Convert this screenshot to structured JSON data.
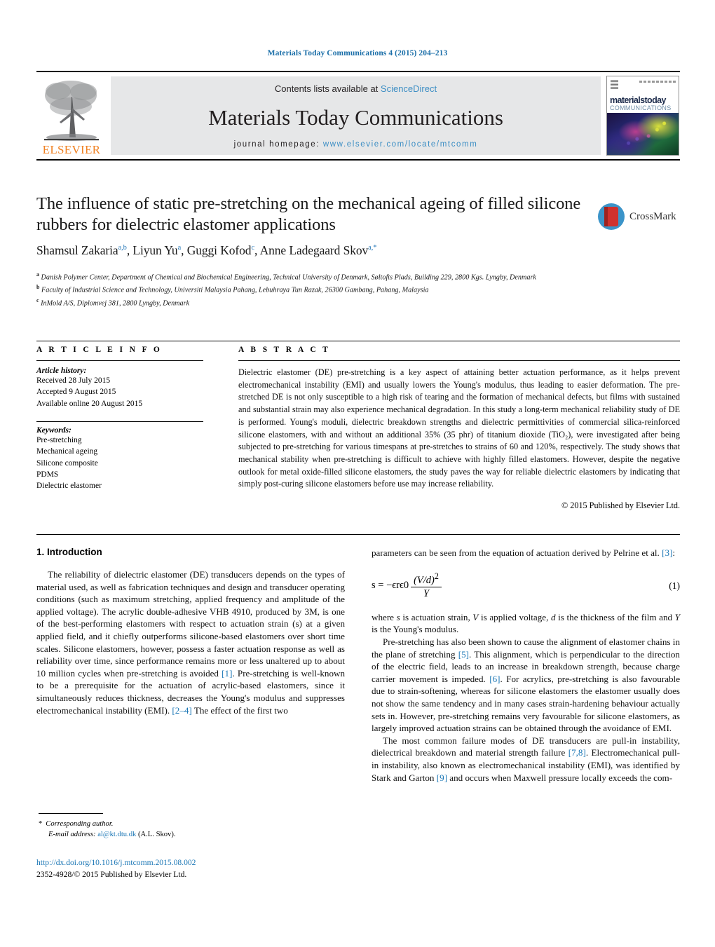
{
  "running_head": "Materials Today Communications 4 (2015) 204–213",
  "masthead": {
    "publisher_word": "ELSEVIER",
    "contents_prefix": "Contents lists available at ",
    "contents_link": "ScienceDirect",
    "journal_name": "Materials Today Communications",
    "homepage_prefix": "journal homepage: ",
    "homepage_url": "www.elsevier.com/locate/mtcomm",
    "cover": {
      "title": "materialstoday",
      "subtitle": "COMMUNICATIONS"
    }
  },
  "article": {
    "title": "The influence of static pre-stretching on the mechanical ageing of filled silicone rubbers for dielectric elastomer applications",
    "crossmark_label": "CrossMark",
    "authors_html": "Shamsul Zakaria<sup>a,b</sup>, Liyun Yu<sup>a</sup>, Guggi Kofod<sup>c</sup>, Anne Ladegaard Skov<sup>a,*</sup>",
    "affiliations": [
      {
        "marker": "a",
        "text": "Danish Polymer Center, Department of Chemical and Biochemical Engineering, Technical University of Denmark, Søltofts Plads, Building 229, 2800 Kgs. Lyngby, Denmark"
      },
      {
        "marker": "b",
        "text": "Faculty of Industrial Science and Technology, Universiti Malaysia Pahang, Lebuhraya Tun Razak, 26300 Gambang, Pahang, Malaysia"
      },
      {
        "marker": "c",
        "text": "InMold A/S, Diplomvej 381, 2800 Lyngby, Denmark"
      }
    ]
  },
  "article_info": {
    "heading": "A R T I C L E    I N F O",
    "history_label": "Article history:",
    "history": [
      "Received 28 July 2015",
      "Accepted 9 August 2015",
      "Available online 20 August 2015"
    ],
    "keywords_label": "Keywords:",
    "keywords": [
      "Pre-stretching",
      "Mechanical ageing",
      "Silicone composite",
      "PDMS",
      "Dielectric elastomer"
    ]
  },
  "abstract": {
    "heading": "A B S T R A C T",
    "text": "Dielectric elastomer (DE) pre-stretching is a key aspect of attaining better actuation performance, as it helps prevent electromechanical instability (EMI) and usually lowers the Young's modulus, thus leading to easier deformation. The pre-stretched DE is not only susceptible to a high risk of tearing and the formation of mechanical defects, but films with sustained and substantial strain may also experience mechanical degradation. In this study a long-term mechanical reliability study of DE is performed. Young's moduli, dielectric breakdown strengths and dielectric permittivities of commercial silica-reinforced silicone elastomers, with and without an additional 35% (35 phr) of titanium dioxide (TiO₂), were investigated after being subjected to pre-stretching for various timespans at pre-stretches to strains of 60 and 120%, respectively. The study shows that mechanical stability when pre-stretching is difficult to achieve with highly filled elastomers. However, despite the negative outlook for metal oxide-filled silicone elastomers, the study paves the way for reliable dielectric elastomers by indicating that simply post-curing silicone elastomers before use may increase reliability.",
    "copyright": "© 2015 Published by Elsevier Ltd."
  },
  "body": {
    "section_heading": "1.  Introduction",
    "left_p1_html": "The reliability of dielectric elastomer (DE) transducers depends on the types of material used, as well as fabrication techniques and design and transducer operating conditions (such as maximum stretching, applied frequency and amplitude of the applied voltage). The acrylic double-adhesive VHB 4910, produced by 3M, is one of the best-performing elastomers with respect to actuation strain (s) at a given applied field, and it chiefly outperforms silicone-based elastomers over short time scales. Silicone elastomers, however, possess a faster actuation response as well as reliability over time, since performance remains more or less unaltered up to about 10 million cycles when pre-stretching is avoided <span class=\"ref\">[1]</span>. Pre-stretching is well-known to be a prerequisite for the actuation of acrylic-based elastomers, since it simultaneously reduces thickness, decreases the Young's modulus and suppresses electromechanical instability (EMI). <span class=\"ref\">[2–4]</span> The effect of the first two",
    "right_p1_html": "parameters can be seen from the equation of actuation derived by Pelrine et al. <span class=\"ref\">[3]</span>:",
    "equation": {
      "lhs": "s = −",
      "eps_r": "ϵr",
      "eps_0": "ϵ0",
      "numerator": "(V/d)",
      "exponent": "2",
      "denominator": "Y",
      "number": "(1)"
    },
    "right_p2_html": "where <i>s</i> is actuation strain, <i>V</i> is applied voltage, <i>d</i> is the thickness of the film and <i>Y</i> is the Young's modulus.",
    "right_p3_html": "Pre-stretching has also been shown to cause the alignment of elastomer chains in the plane of stretching <span class=\"ref\">[5]</span>. This alignment, which is perpendicular to the direction of the electric field, leads to an increase in breakdown strength, because charge carrier movement is impeded. <span class=\"ref\">[6]</span>. For acrylics, pre-stretching is also favourable due to strain-softening, whereas for silicone elastomers the elastomer usually does not show the same tendency and in many cases strain-hardening behaviour actually sets in. However, pre-stretching remains very favourable for silicone elastomers, as largely improved actuation strains can be obtained through the avoidance of EMI.",
    "right_p4_html": "The most common failure modes of DE transducers are pull-in instability, dielectrical breakdown and material strength failure <span class=\"ref\">[7,8]</span>. Electromechanical pull-in instability, also known as electromechanical instability (EMI), was identified by Stark and Garton <span class=\"ref\">[9]</span> and occurs when Maxwell pressure locally exceeds the com-"
  },
  "footer": {
    "corresponding_marker": "*",
    "corresponding_label": "Corresponding author.",
    "email_label": "E-mail address:",
    "email": "al@kt.dtu.dk",
    "email_owner": "(A.L. Skov).",
    "doi_url": "http://dx.doi.org/10.1016/j.mtcomm.2015.08.002",
    "issn_line": "2352-4928/© 2015 Published by Elsevier Ltd."
  },
  "colors": {
    "link": "#1a76b5",
    "running_head": "#1a6ea8",
    "elsevier_orange": "#f08122",
    "banner_gray": "#e6e7e8"
  }
}
